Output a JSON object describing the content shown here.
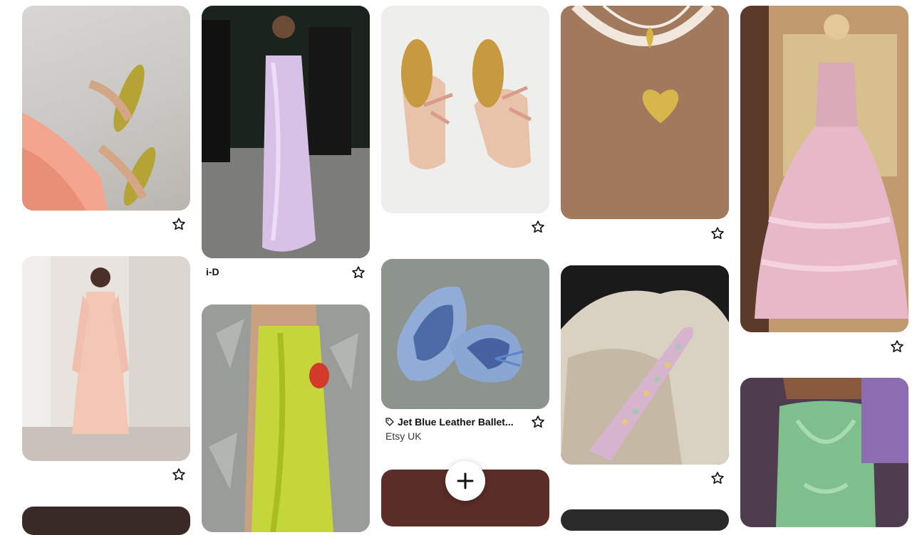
{
  "pins": [
    {
      "name": "pin-pink-dress-green-heels",
      "alt": ""
    },
    {
      "name": "pin-lavender-satin-gown",
      "title": "i-D"
    },
    {
      "name": "pin-pink-bow-mules"
    },
    {
      "name": "pin-heart-locket-necklace"
    },
    {
      "name": "pin-pink-ruffled-gown"
    },
    {
      "name": "pin-peach-maxi-dress"
    },
    {
      "name": "pin-lime-slip-dress"
    },
    {
      "name": "pin-blue-ballet-flats",
      "title": "Jet Blue Leather Ballet...",
      "source": "Etsy UK"
    },
    {
      "name": "pin-sequin-clutch"
    },
    {
      "name": "pin-green-satin-dress"
    }
  ],
  "colors": {
    "accent": "#111111",
    "star": "#111111"
  },
  "fab": {
    "icon": "plus-icon"
  }
}
